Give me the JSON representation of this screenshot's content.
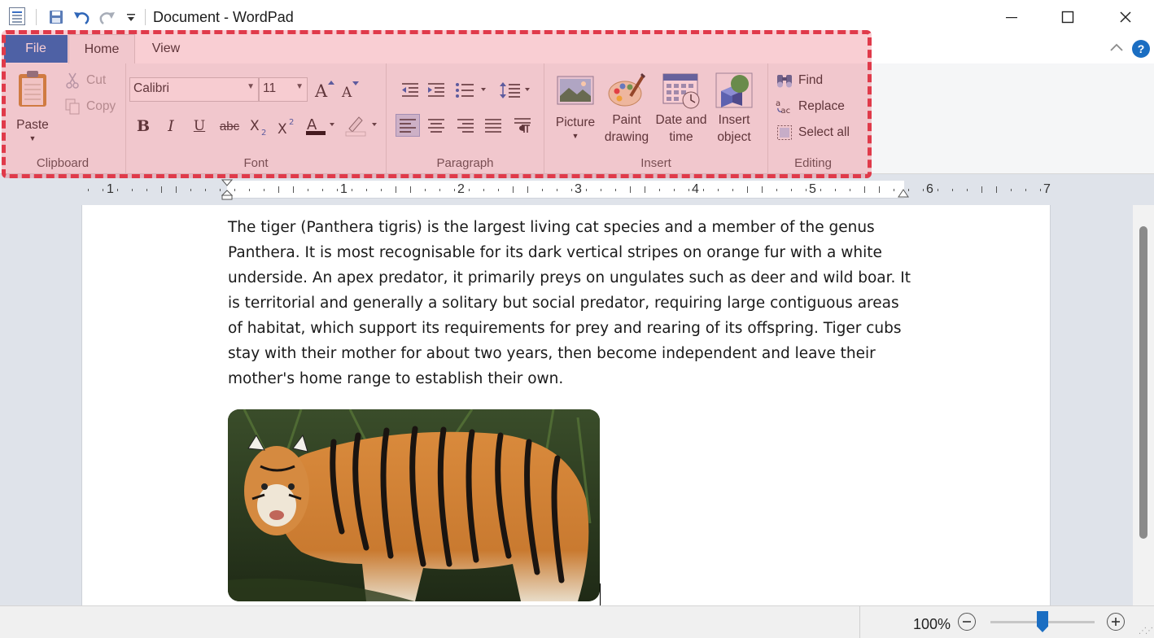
{
  "window": {
    "title": "Document - WordPad",
    "minimize_glyph": "—",
    "maximize_glyph": "☐",
    "close_glyph": "✕"
  },
  "quick_access": {
    "icons": [
      "wordpad-app-icon",
      "save-icon",
      "undo-icon",
      "redo-icon",
      "customize-qat-icon"
    ]
  },
  "ribbon": {
    "tabs": [
      {
        "label": "File"
      },
      {
        "label": "Home"
      },
      {
        "label": "View"
      }
    ],
    "clipboard": {
      "group_label": "Clipboard",
      "paste_label": "Paste",
      "cut_label": "Cut",
      "copy_label": "Copy"
    },
    "font": {
      "group_label": "Font",
      "font_family": "Calibri",
      "font_size": "11"
    },
    "paragraph": {
      "group_label": "Paragraph"
    },
    "insert": {
      "group_label": "Insert",
      "picture_label": "Picture",
      "paint_line1": "Paint",
      "paint_line2": "drawing",
      "datetime_line1": "Date and",
      "datetime_line2": "time",
      "object_line1": "Insert",
      "object_line2": "object"
    },
    "editing": {
      "group_label": "Editing",
      "find_label": "Find",
      "replace_label": "Replace",
      "select_all_label": "Select all"
    }
  },
  "ruler": {
    "numbers": [
      "1",
      "1",
      "2",
      "3",
      "4",
      "5",
      "6",
      "7"
    ]
  },
  "document": {
    "paragraph": "The tiger (Panthera tigris) is the largest living cat species and a member of the genus Panthera. It is most recognisable for its dark vertical stripes on orange fur with a white underside. An apex predator, it primarily preys on ungulates such as deer and wild boar. It is territorial and generally a solitary but social predator, requiring large contiguous areas of habitat, which support its requirements for prey and rearing of its offspring. Tiger cubs stay with their mother for about two years, then become independent and leave their mother's home range to establish their own.",
    "image_alt": "tiger photo"
  },
  "status": {
    "zoom_label": "100%",
    "zoom_level_percent": 100
  },
  "colors": {
    "accent": "#1b6ec2",
    "highlight_border": "#e03a4a"
  }
}
